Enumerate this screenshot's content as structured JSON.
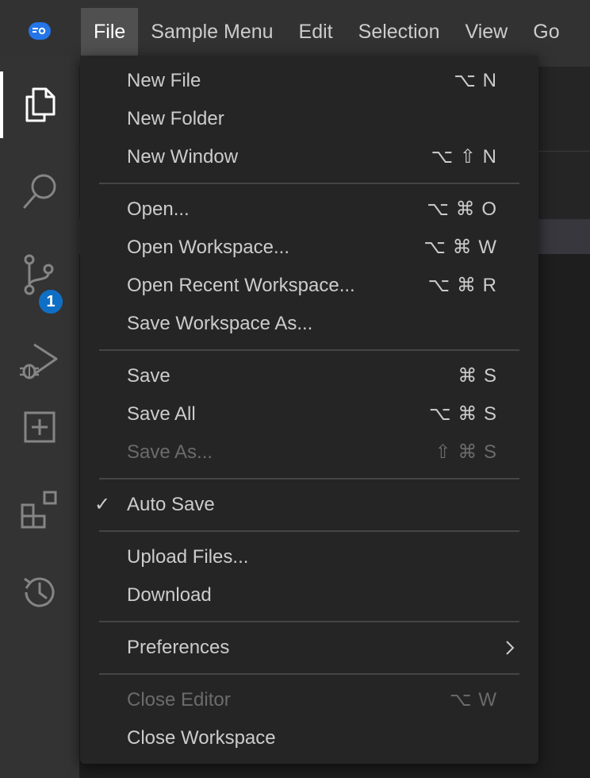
{
  "menubar": {
    "items": [
      {
        "label": "File",
        "active": true
      },
      {
        "label": "Sample Menu"
      },
      {
        "label": "Edit"
      },
      {
        "label": "Selection"
      },
      {
        "label": "View"
      },
      {
        "label": "Go"
      }
    ]
  },
  "activity_bar": {
    "items": [
      {
        "name": "explorer-icon",
        "active": true
      },
      {
        "name": "search-icon"
      },
      {
        "name": "source-control-icon",
        "badge": "1"
      },
      {
        "name": "run-debug-icon"
      },
      {
        "name": "add-square-icon"
      },
      {
        "name": "extensions-icon"
      },
      {
        "name": "history-icon"
      }
    ]
  },
  "file_menu": {
    "groups": [
      [
        {
          "label": "New File",
          "shortcut": "⌥ N"
        },
        {
          "label": "New Folder",
          "shortcut": ""
        },
        {
          "label": "New Window",
          "shortcut": "⌥ ⇧ N"
        }
      ],
      [
        {
          "label": "Open...",
          "shortcut": "⌥ ⌘ O"
        },
        {
          "label": "Open Workspace...",
          "shortcut": "⌥ ⌘ W"
        },
        {
          "label": "Open Recent Workspace...",
          "shortcut": "⌥ ⌘ R"
        },
        {
          "label": "Save Workspace As...",
          "shortcut": ""
        }
      ],
      [
        {
          "label": "Save",
          "shortcut": "⌘ S"
        },
        {
          "label": "Save All",
          "shortcut": "⌥ ⌘ S"
        },
        {
          "label": "Save As...",
          "shortcut": "⇧ ⌘ S",
          "disabled": true
        }
      ],
      [
        {
          "label": "Auto Save",
          "shortcut": "",
          "checked": true
        }
      ],
      [
        {
          "label": "Upload Files...",
          "shortcut": ""
        },
        {
          "label": "Download",
          "shortcut": ""
        }
      ],
      [
        {
          "label": "Preferences",
          "shortcut": "",
          "submenu": true
        }
      ],
      [
        {
          "label": "Close Editor",
          "shortcut": "⌥ W",
          "disabled": true
        },
        {
          "label": "Close Workspace",
          "shortcut": ""
        }
      ]
    ]
  },
  "colors": {
    "accent": "#2475e8",
    "badge": "#0f6fc5",
    "menu_bg": "#252526",
    "disabled_text": "#6b6b6b"
  }
}
